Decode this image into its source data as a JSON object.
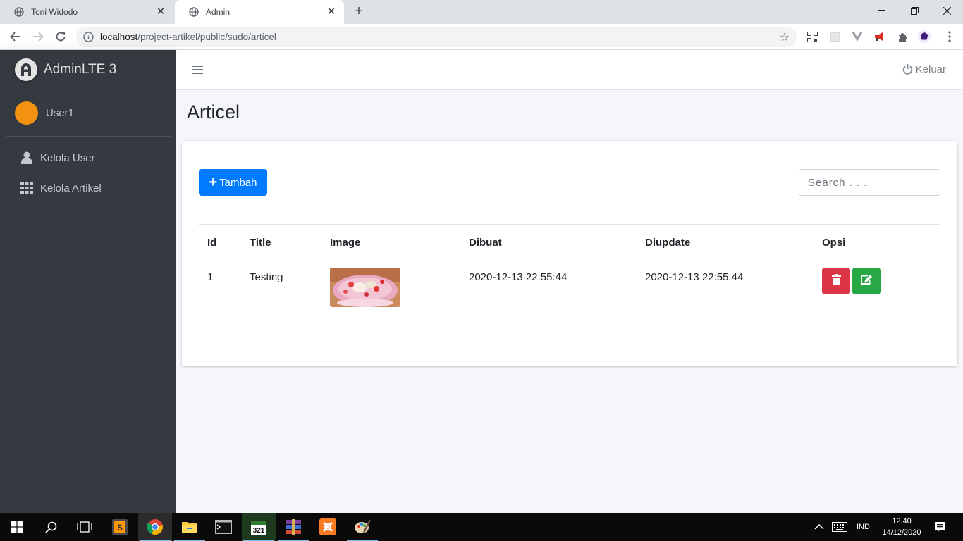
{
  "browser": {
    "tabs": [
      {
        "title": "Toni Widodo",
        "active": false
      },
      {
        "title": "Admin",
        "active": true
      }
    ],
    "url_host": "localhost",
    "url_path": "/project-artikel/public/sudo/articel"
  },
  "sidebar": {
    "brand": "AdminLTE 3",
    "user": "User1",
    "items": [
      {
        "label": "Kelola User",
        "icon": "user-icon"
      },
      {
        "label": "Kelola Artikel",
        "icon": "grid-icon"
      }
    ]
  },
  "navbar": {
    "logout_label": "Keluar"
  },
  "page": {
    "title": "Articel",
    "add_button": "Tambah",
    "search_placeholder": "Search . . ."
  },
  "table": {
    "headers": [
      "Id",
      "Title",
      "Image",
      "Dibuat",
      "Diupdate",
      "Opsi"
    ],
    "rows": [
      {
        "id": "1",
        "title": "Testing",
        "created": "2020-12-13 22:55:44",
        "updated": "2020-12-13 22:55:44"
      }
    ]
  },
  "taskbar": {
    "lang": "IND",
    "time": "12.40",
    "date": "14/12/2020"
  },
  "colors": {
    "sidebar_bg": "#343a40",
    "primary": "#007bff",
    "danger": "#dc3545",
    "success": "#28a745",
    "avatar": "#f39211"
  }
}
